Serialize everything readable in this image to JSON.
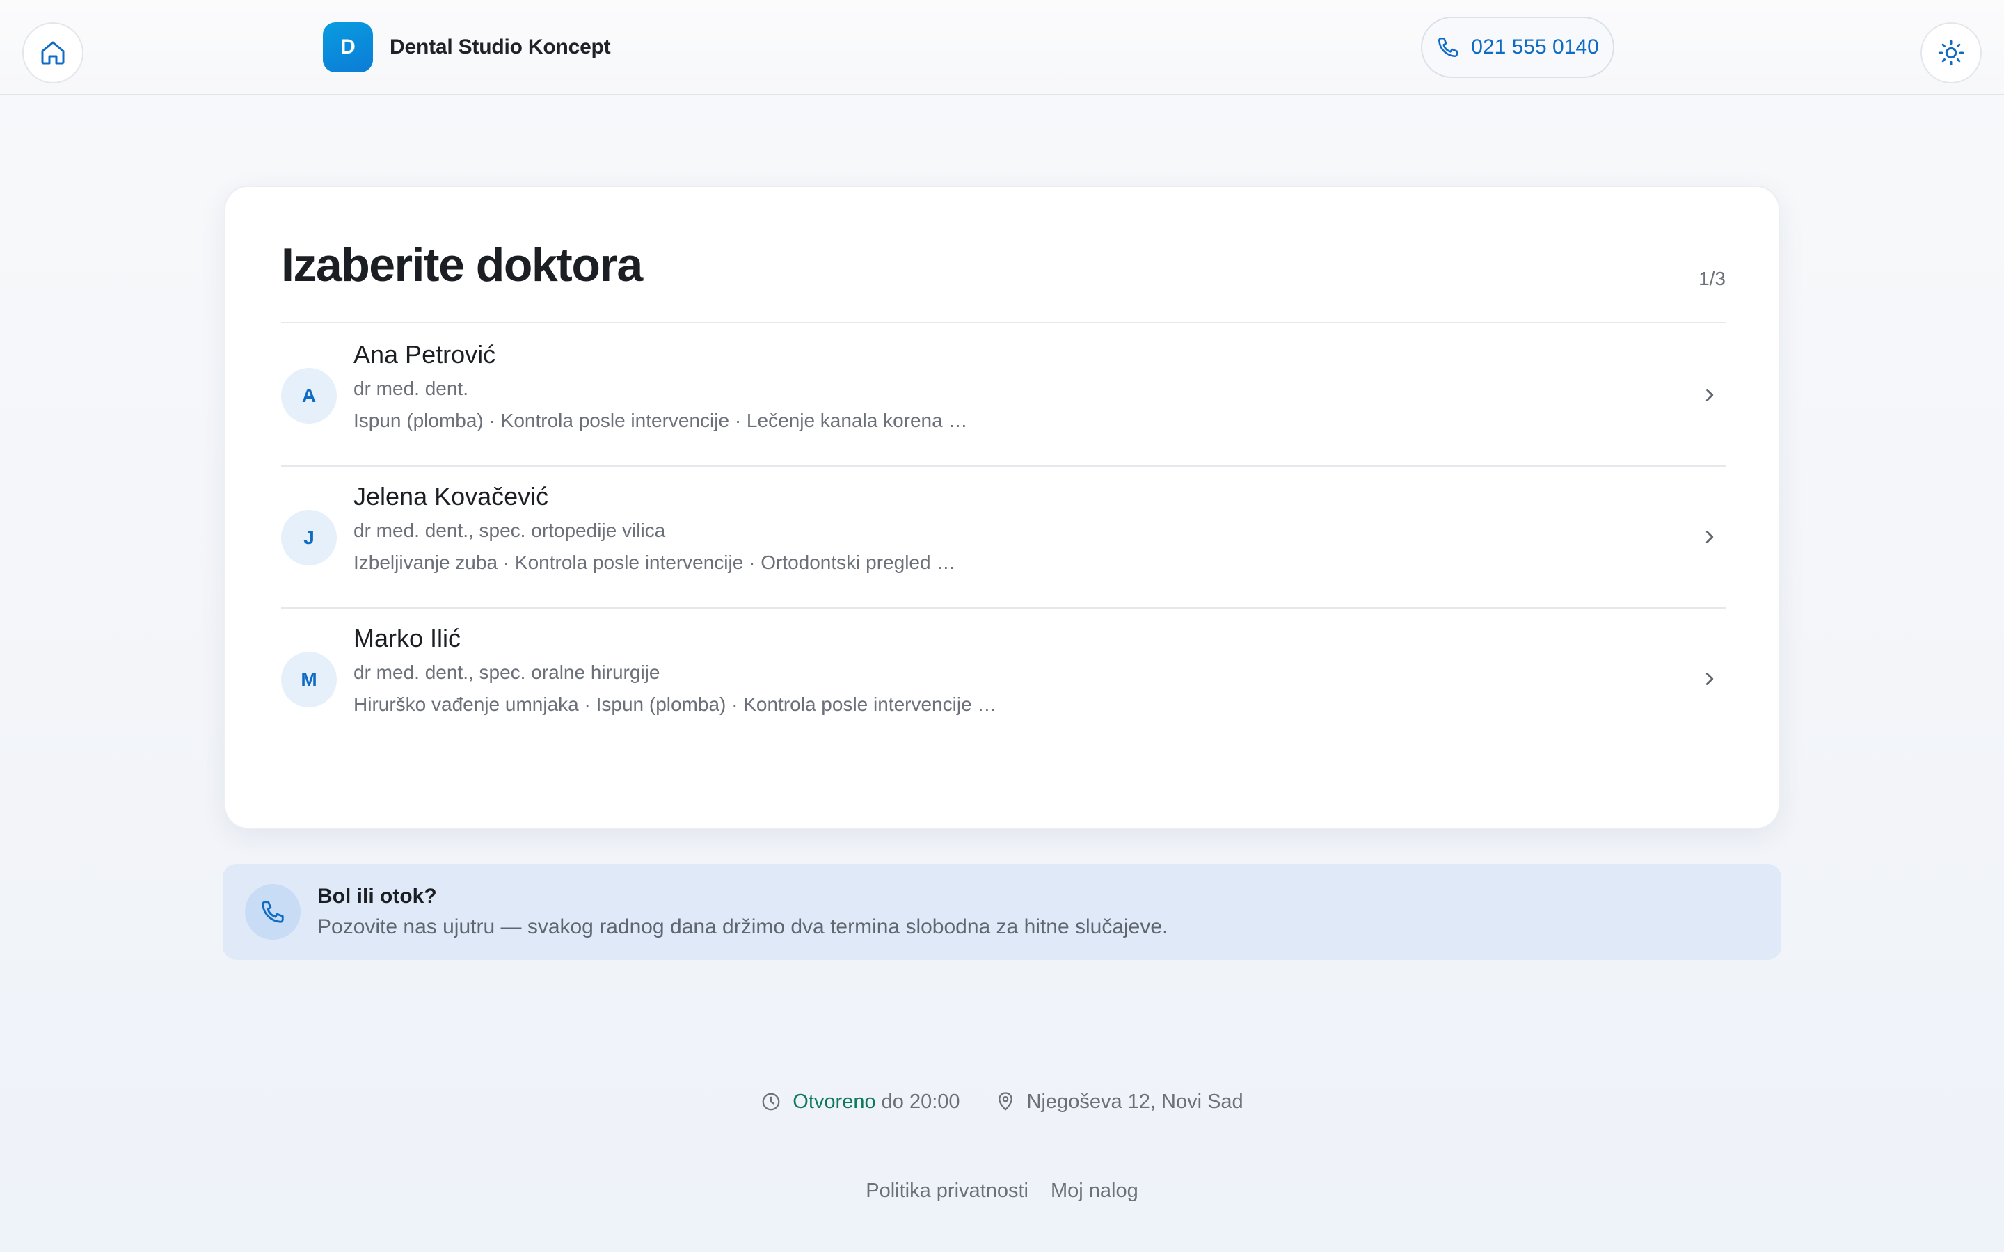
{
  "header": {
    "home_icon": "home-icon",
    "brand_initial": "D",
    "brand_name": "Dental Studio Koncept",
    "phone_icon": "phone-icon",
    "phone": "021 555 0140",
    "theme_icon": "sun-icon"
  },
  "card": {
    "title": "Izaberite doktora",
    "step": "1/3",
    "doctors": [
      {
        "initial": "A",
        "name": "Ana Petrović",
        "title": "dr med. dent.",
        "services": "Ispun (plomba) · Kontrola posle intervencije · Lečenje kanala korena …"
      },
      {
        "initial": "J",
        "name": "Jelena Kovačević",
        "title": "dr med. dent., spec. ortopedije vilica",
        "services": "Izbeljivanje zuba · Kontrola posle intervencije · Ortodontski pregled …"
      },
      {
        "initial": "M",
        "name": "Marko Ilić",
        "title": "dr med. dent., spec. oralne hirurgije",
        "services": "Hirurško vađenje umnjaka · Ispun (plomba) · Kontrola posle intervencije …"
      }
    ]
  },
  "urgent": {
    "title": "Bol ili otok?",
    "text": "Pozovite nas ujutru — svakog radnog dana držimo dva termina slobodna za hitne slučajeve."
  },
  "footer": {
    "open_status": "Otvoreno",
    "open_until": " do 20:00",
    "address": "Njegoševa 12, Novi Sad",
    "links": [
      "Politika privatnosti",
      "Moj nalog"
    ]
  },
  "colors": {
    "accent": "#0f6cc4",
    "brand_logo": "#0a9ce0",
    "open_status": "#0c7a5a",
    "urgent_bg": "#dfe9f8"
  }
}
